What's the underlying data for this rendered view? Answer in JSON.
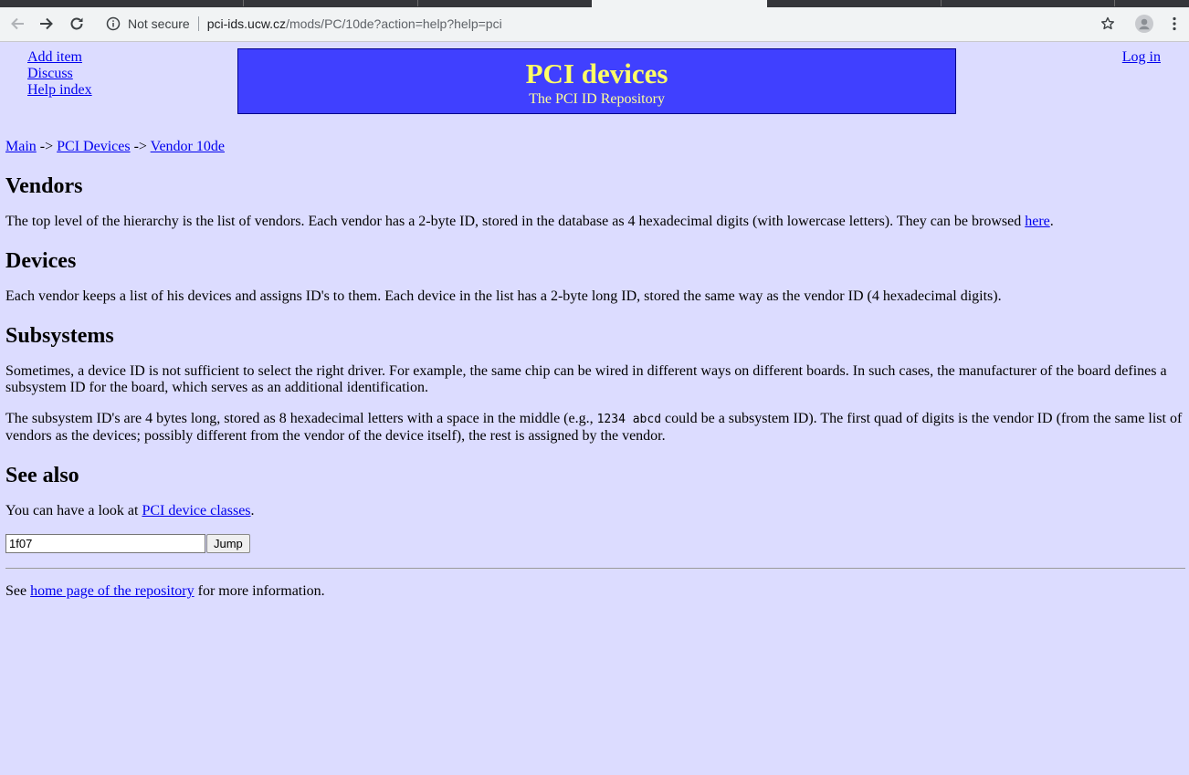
{
  "browser": {
    "security_label": "Not secure",
    "url_host": "pci-ids.ucw.cz",
    "url_path": "/mods/PC/10de?action=help?help=pci",
    "icons": [
      "back-icon",
      "forward-icon",
      "reload-icon",
      "info-icon",
      "star-icon",
      "profile-icon",
      "menu-icon"
    ]
  },
  "nav": {
    "add_item": "Add item",
    "discuss": "Discuss",
    "help_index": "Help index",
    "login": "Log in"
  },
  "banner": {
    "title": "PCI devices",
    "subtitle": "The PCI ID Repository"
  },
  "breadcrumb": {
    "items": [
      "Main",
      "PCI Devices",
      "Vendor 10de"
    ],
    "separator": "->"
  },
  "sections": {
    "vendors": {
      "heading": "Vendors",
      "text": "The top level of the hierarchy is the list of vendors. Each vendor has a 2-byte ID, stored in the database as 4 hexadecimal digits (with lowercase letters). They can be browsed ",
      "link": "here",
      "tail": "."
    },
    "devices": {
      "heading": "Devices",
      "text": "Each vendor keeps a list of his devices and assigns ID's to them. Each device in the list has a 2-byte long ID, stored the same way as the vendor ID (4 hexadecimal digits)."
    },
    "subsystems": {
      "heading": "Subsystems",
      "p1": "Sometimes, a device ID is not sufficient to select the right driver. For example, the same chip can be wired in different ways on different boards. In such cases, the manufacturer of the board defines a subsystem ID for the board, which serves as an additional identification.",
      "p2_start": "The subsystem ID's are 4 bytes long, stored as 8 hexadecimal letters with a space in the middle (e.g., ",
      "p2_code": "1234 abcd",
      "p2_end": " could be a subsystem ID). The first quad of digits is the vendor ID (from the same list of vendors as the devices; possibly different from the vendor of the device itself), the rest is assigned by the vendor."
    },
    "see_also": {
      "heading": "See also",
      "text": "You can have a look at ",
      "link": "PCI device classes",
      "tail": "."
    }
  },
  "jump": {
    "value": "1f07",
    "button": "Jump"
  },
  "footer": {
    "text": "See ",
    "link": "home page of the repository",
    "tail": " for more information."
  },
  "colors": {
    "page_bg": "#dcdcff",
    "banner_bg": "#4040ff",
    "banner_title": "#ffff66",
    "link": "#0000ee"
  }
}
